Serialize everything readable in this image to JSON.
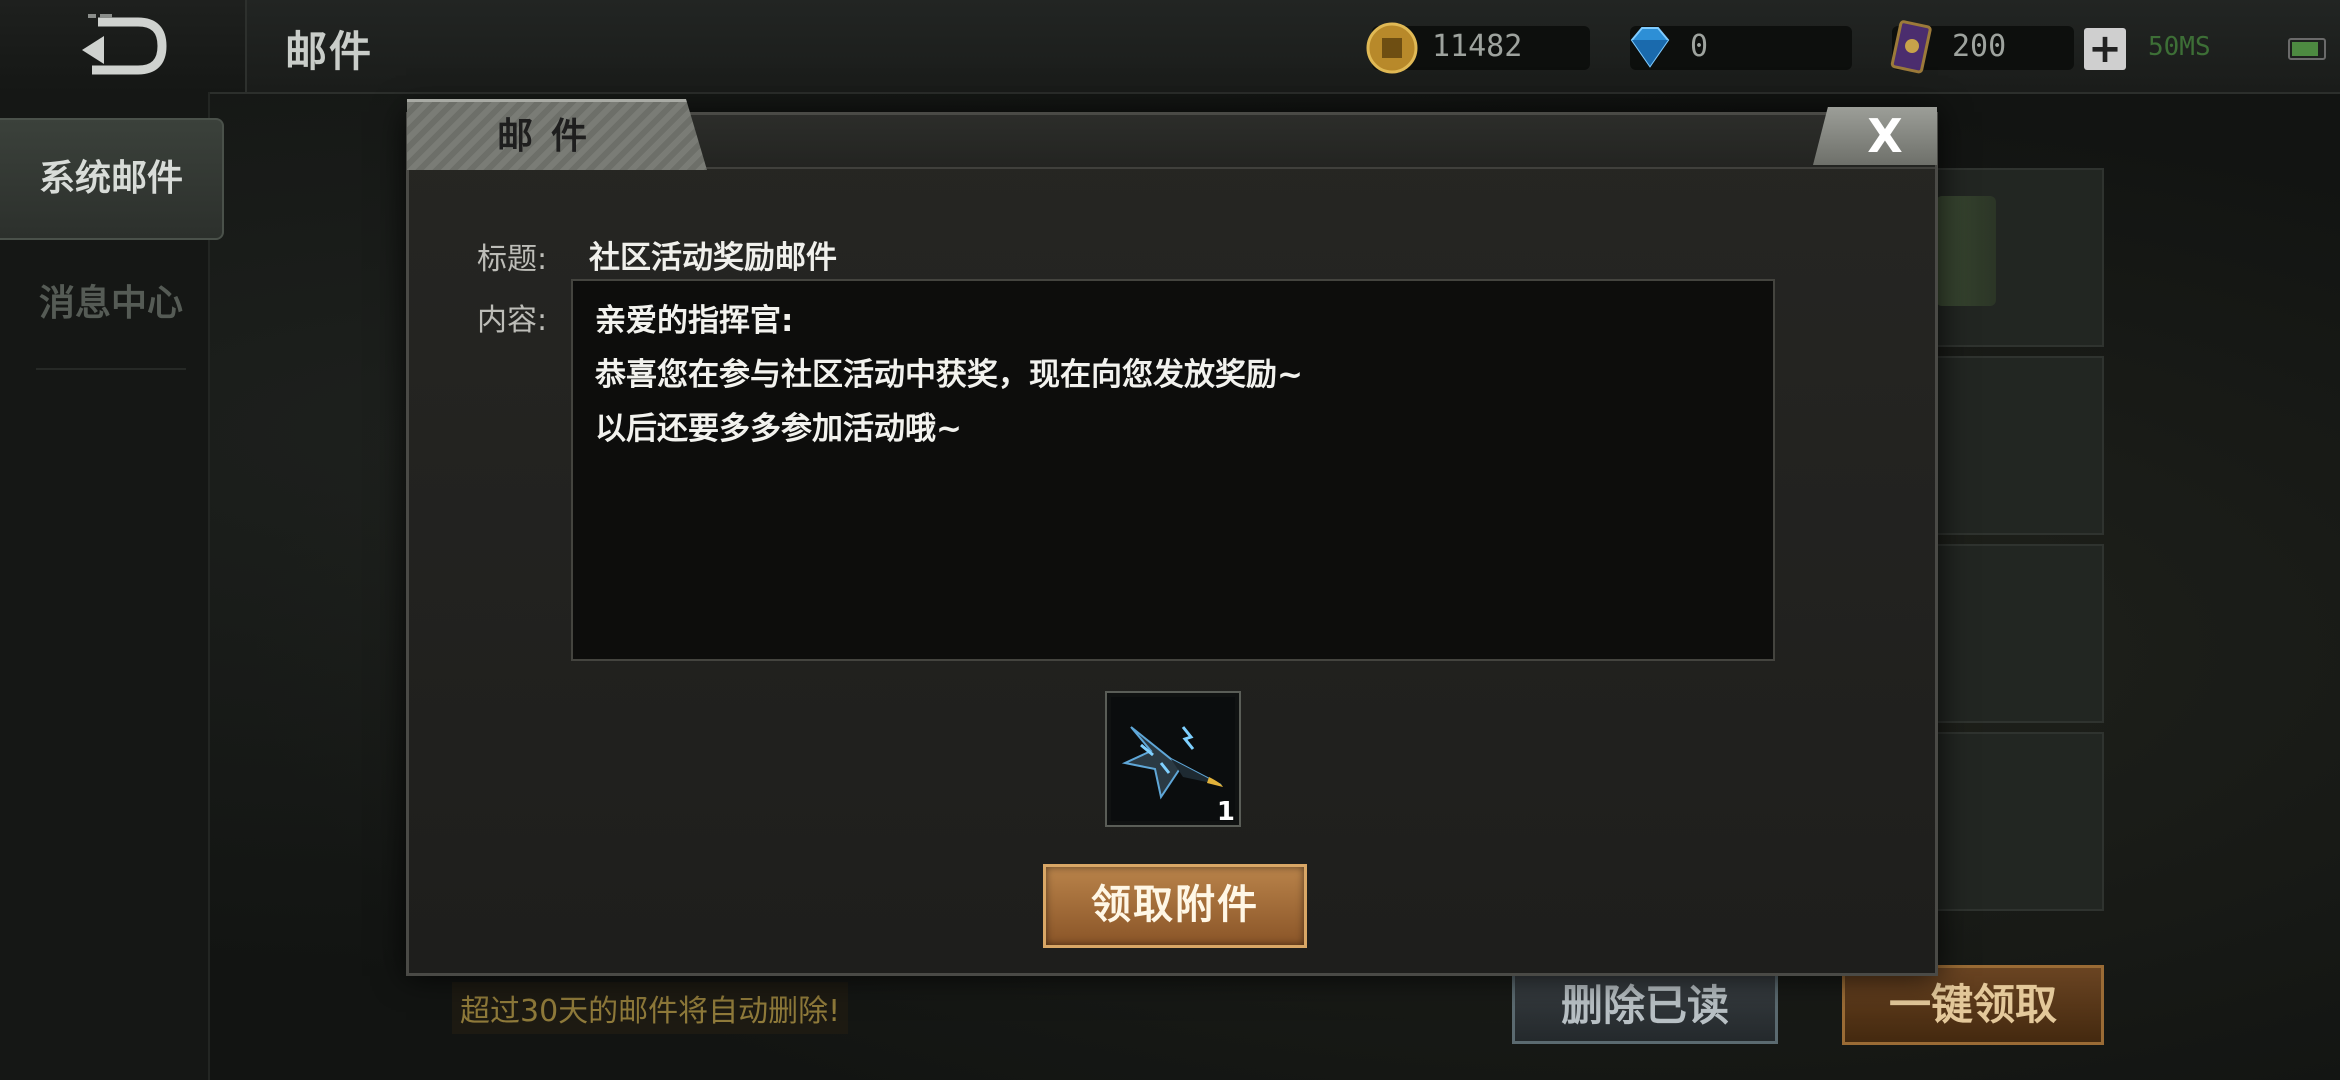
{
  "top_bar": {
    "title": "邮件",
    "resources": {
      "gold": "11482",
      "diamond": "0",
      "card": "200"
    },
    "ping": "50MS"
  },
  "sidebar": {
    "items": [
      {
        "label": "系统邮件",
        "active": true
      },
      {
        "label": "消息中心",
        "active": false
      }
    ]
  },
  "bottom": {
    "notice": "超过30天的邮件将自动删除!",
    "delete_read": "删除已读",
    "claim_all": "一键领取"
  },
  "dialog": {
    "tab_label": "邮件",
    "close_label": "X",
    "subject_label": "标题:",
    "subject": "社区活动奖励邮件",
    "content_label": "内容:",
    "content_lines": [
      "亲爱的指挥官:",
      "恭喜您在参与社区活动中获奖，现在向您发放奖励~",
      "以后还要多多参加活动哦~"
    ],
    "attachment": {
      "icon": "fighter-jet-icon",
      "count": "1"
    },
    "claim_button": "领取附件"
  },
  "colors": {
    "claim_button": "#a86f3a",
    "delete_button_border": "#5b6a70",
    "ping": "#3d6f36"
  }
}
